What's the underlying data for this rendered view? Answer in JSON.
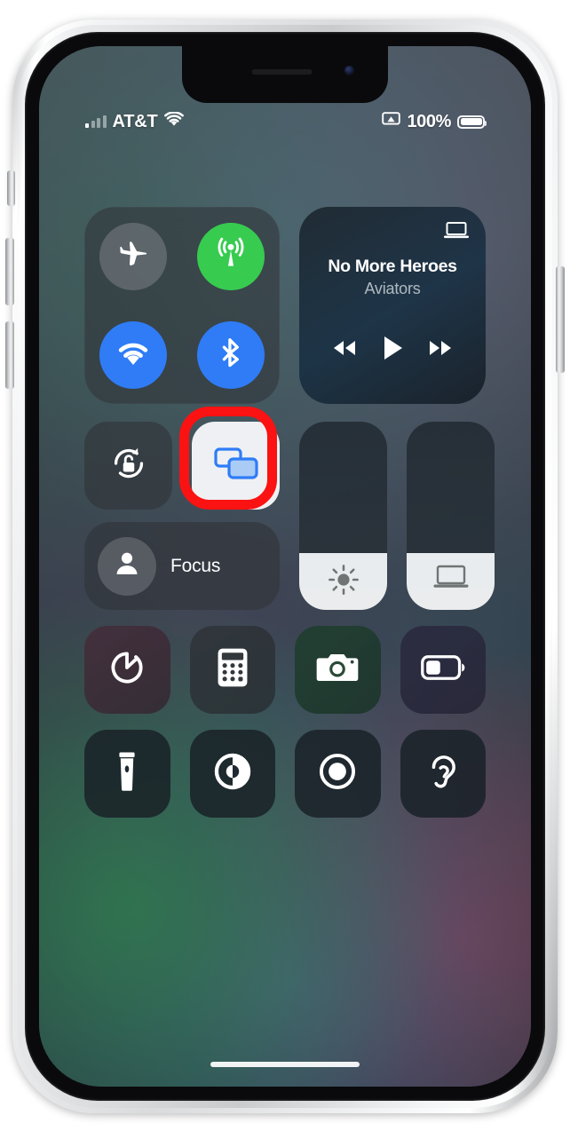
{
  "device": {
    "kind": "iphone-with-notch",
    "frame_color": "#d9dbdd",
    "accent_highlight": "#fb1212"
  },
  "status_bar": {
    "carrier": "AT&T",
    "signal_icon": "cellular-signal-bars",
    "wifi_icon": "wifi-icon",
    "screen_mirroring_icon": "screen-mirroring-icon",
    "battery_percent": "100%",
    "battery_icon": "battery-full-icon"
  },
  "control_center": {
    "connectivity": {
      "module_name": "connectivity-module",
      "toggles": [
        {
          "id": "airplane-mode",
          "icon": "airplane-icon",
          "state": "off",
          "color": "#7e8288"
        },
        {
          "id": "cellular-data",
          "icon": "cellular-antenna-icon",
          "state": "on",
          "color": "#37cc50"
        },
        {
          "id": "wifi",
          "icon": "wifi-icon",
          "state": "on",
          "color": "#2f7cf6"
        },
        {
          "id": "bluetooth",
          "icon": "bluetooth-icon",
          "state": "on",
          "color": "#2f7cf6"
        }
      ]
    },
    "now_playing": {
      "module_name": "now-playing-module",
      "title": "No More Heroes",
      "artist": "Aviators",
      "output_icon": "laptop-airplay-icon",
      "controls": [
        {
          "id": "rewind",
          "icon": "rewind-icon"
        },
        {
          "id": "play",
          "icon": "play-icon"
        },
        {
          "id": "fast-forward",
          "icon": "fast-forward-icon"
        }
      ]
    },
    "orientation_lock": {
      "id": "rotation-lock",
      "icon": "rotation-lock-icon",
      "state": "unlocked"
    },
    "screen_mirroring": {
      "id": "screen-mirroring",
      "icon": "screen-mirroring-icon",
      "state": "active",
      "highlighted": true,
      "highlight_color": "#fb1212"
    },
    "focus": {
      "id": "focus",
      "label": "Focus",
      "icon": "person-icon"
    },
    "sliders": [
      {
        "id": "brightness",
        "icon": "brightness-sun-icon",
        "level_percent": 30
      },
      {
        "id": "volume",
        "icon": "laptop-output-icon",
        "level_percent": 30
      }
    ],
    "tiles_row_1": [
      {
        "id": "timer",
        "icon": "timer-icon"
      },
      {
        "id": "calculator",
        "icon": "calculator-icon"
      },
      {
        "id": "camera",
        "icon": "camera-icon"
      },
      {
        "id": "low-power-mode",
        "icon": "battery-low-power-icon"
      }
    ],
    "tiles_row_2": [
      {
        "id": "flashlight",
        "icon": "flashlight-icon"
      },
      {
        "id": "dark-mode",
        "icon": "contrast-circle-icon"
      },
      {
        "id": "screen-record",
        "icon": "screen-record-icon"
      },
      {
        "id": "hearing",
        "icon": "ear-hearing-icon"
      }
    ]
  },
  "home_indicator": {
    "name": "home-indicator"
  }
}
